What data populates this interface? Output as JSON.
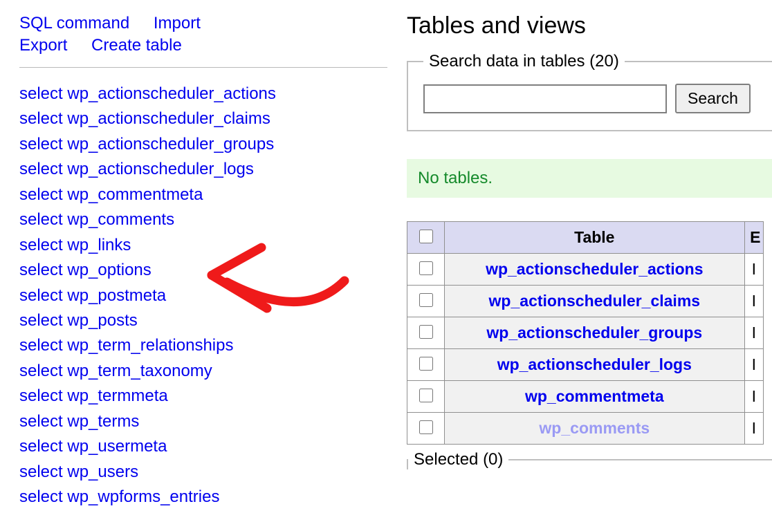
{
  "toplinks": {
    "sql_command": "SQL command",
    "import": "Import",
    "export": "Export",
    "create_table": "Create table"
  },
  "tables": [
    "wp_actionscheduler_actions",
    "wp_actionscheduler_claims",
    "wp_actionscheduler_groups",
    "wp_actionscheduler_logs",
    "wp_commentmeta",
    "wp_comments",
    "wp_links",
    "wp_options",
    "wp_postmeta",
    "wp_posts",
    "wp_term_relationships",
    "wp_term_taxonomy",
    "wp_termmeta",
    "wp_terms",
    "wp_usermeta",
    "wp_users",
    "wp_wpforms_entries"
  ],
  "select_prefix": "select",
  "main": {
    "heading": "Tables and views",
    "search_legend": "Search data in tables (20)",
    "search_btn": "Search",
    "notice": "No tables.",
    "col_table": "Table",
    "col_engine": "E",
    "engine_initial": "I",
    "rows": [
      "wp_actionscheduler_actions",
      "wp_actionscheduler_claims",
      "wp_actionscheduler_groups",
      "wp_actionscheduler_logs",
      "wp_commentmeta",
      "wp_comments"
    ],
    "selected_legend": "Selected (0)"
  }
}
